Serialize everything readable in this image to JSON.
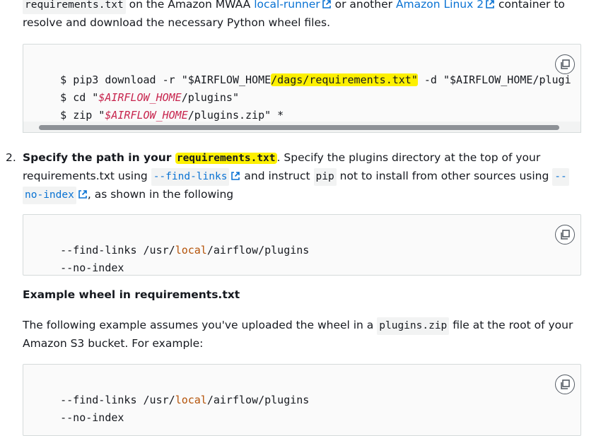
{
  "intro": {
    "code1": "requirements.txt",
    "text1": " on the Amazon MWAA ",
    "link1": "local-runner",
    "text2": " or another ",
    "link2": "Amazon Linux 2",
    "text3": " container to",
    "line2": "resolve and download the necessary Python wheel files."
  },
  "code_block_1": {
    "prompt": "$ ",
    "line1_cmd": "pip3 download -r \"$AIRFLOW_HOME",
    "line1_hl": "/dags/requirements.txt\"",
    "line1_rest": " -d \"$AIRFLOW_HOME/plugi",
    "line2_cmd": "cd \"",
    "line2_var": "$AIRFLOW_HOME",
    "line2_rest": "/plugins\"",
    "line3_cmd": "zip \"",
    "line3_var": "$AIRFLOW_HOME",
    "line3_rest": "/plugins.zip\" *"
  },
  "step2": {
    "number": "2.",
    "bold": "Specify the path in your ",
    "bold_code": "requirements.txt",
    "text1": ". Specify the plugins directory at the top of your",
    "text2": "requirements.txt using ",
    "code_find": "--find-links",
    "text3": " and instruct ",
    "code_pip": "pip",
    "text4": " not to install from other sources using ",
    "code_noindex_a": "--",
    "code_noindex_b": "no-index",
    "text5": ", as shown in the following"
  },
  "code_block_2": {
    "line1_a": "--find-links ",
    "line1_b": "/usr/",
    "line1_c": "local",
    "line1_d": "/airflow/plugins",
    "line2": "--no-index"
  },
  "example_heading": "Example wheel in requirements.txt",
  "example_para": {
    "text1": "The following example assumes you've uploaded the wheel in a ",
    "code": "plugins.zip",
    "text2": " file at the root of your",
    "line2": "Amazon S3 bucket. For example:"
  },
  "code_block_3": {
    "line1_a": "--find-links ",
    "line1_b": "/usr/",
    "line1_c": "local",
    "line1_d": "/airflow/plugins",
    "line2": "--no-index"
  },
  "colors": {
    "link": "#0972d3",
    "highlight": "#fdf001",
    "code_bg": "#fafafa",
    "border": "#d5dbdb"
  },
  "icons": {
    "external": "external-link-icon",
    "copy": "copy-icon"
  }
}
